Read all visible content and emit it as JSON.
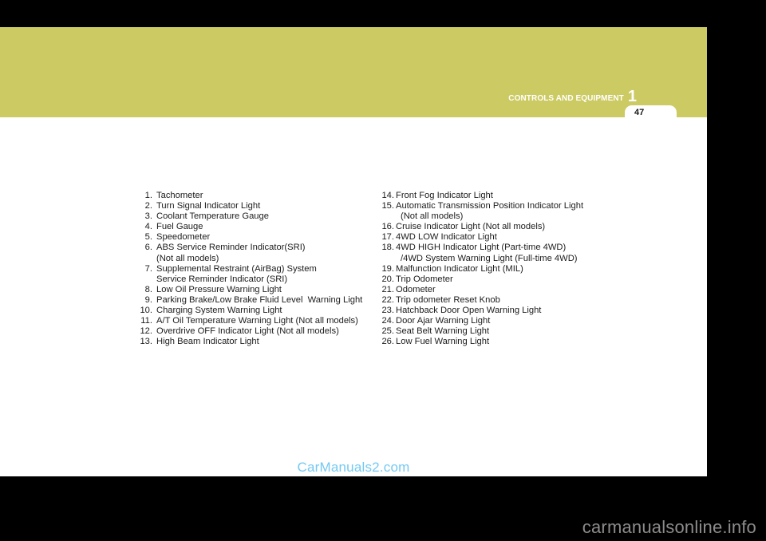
{
  "chapter": {
    "title": "CONTROLS AND EQUIPMENT",
    "number": "1",
    "band_color": "#ccca63"
  },
  "page": {
    "number": "47",
    "background": "#ffffff"
  },
  "legend": {
    "left_column": [
      {
        "num": "1.",
        "text": "Tachometer"
      },
      {
        "num": "2.",
        "text": "Turn Signal Indicator Light"
      },
      {
        "num": "3.",
        "text": "Coolant Temperature Gauge"
      },
      {
        "num": "4.",
        "text": "Fuel Gauge"
      },
      {
        "num": "5.",
        "text": "Speedometer"
      },
      {
        "num": "6.",
        "text": "ABS Service Reminder Indicator(SRI)",
        "cont": "(Not all models)"
      },
      {
        "num": "7.",
        "text": "Supplemental Restraint (AirBag) System",
        "cont": "Service Reminder Indicator (SRI)"
      },
      {
        "num": "8.",
        "text": "Low Oil Pressure Warning Light"
      },
      {
        "num": "9.",
        "text": "Parking Brake/Low Brake Fluid Level  Warning Light"
      },
      {
        "num": "10.",
        "text": "Charging System Warning Light"
      },
      {
        "num": "11.",
        "text": "A/T Oil Temperature Warning Light (Not all models)"
      },
      {
        "num": "12.",
        "text": "Overdrive OFF Indicator Light (Not all models)"
      },
      {
        "num": "13.",
        "text": "High Beam Indicator Light"
      }
    ],
    "right_column": [
      {
        "num": "14.",
        "text": "Front Fog Indicator Light"
      },
      {
        "num": "15.",
        "text": "Automatic Transmission Position Indicator Light",
        "cont": "(Not all models)"
      },
      {
        "num": "16.",
        "text": "Cruise Indicator Light (Not all models)"
      },
      {
        "num": "17.",
        "text": "4WD LOW Indicator Light"
      },
      {
        "num": "18.",
        "text": "4WD HIGH Indicator Light (Part-time 4WD)",
        "cont": "/4WD System Warning Light (Full-time 4WD)"
      },
      {
        "num": "19.",
        "text": "Malfunction Indicator Light (MIL)"
      },
      {
        "num": "20.",
        "text": "Trip Odometer"
      },
      {
        "num": "21.",
        "text": "Odometer"
      },
      {
        "num": "22.",
        "text": "Trip odometer Reset Knob"
      },
      {
        "num": "23.",
        "text": "Hatchback Door Open Warning Light"
      },
      {
        "num": "24.",
        "text": "Door Ajar Warning Light"
      },
      {
        "num": "25.",
        "text": "Seat Belt Warning Light"
      },
      {
        "num": "26.",
        "text": "Low Fuel Warning Light"
      }
    ]
  },
  "watermarks": {
    "page_overlay": "CarManuals2.com",
    "page_overlay_color": "#74c9f2",
    "bottom_right": "carmanualsonline.info",
    "bottom_right_color": "#8c8c8c"
  }
}
